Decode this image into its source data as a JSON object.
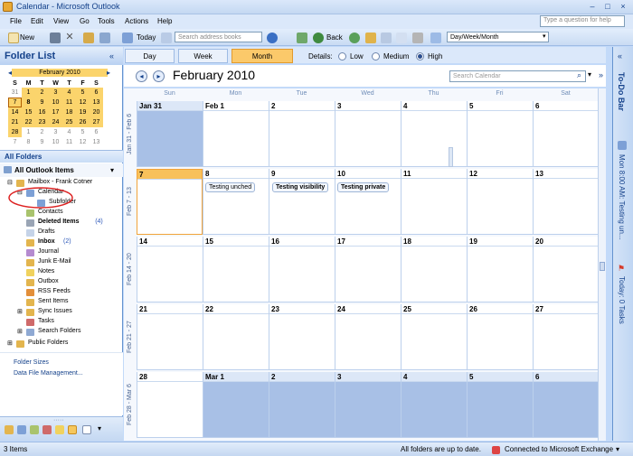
{
  "window": {
    "title": "Calendar - Microsoft Outlook",
    "controls": [
      "–",
      "□",
      "×"
    ]
  },
  "menu": [
    "File",
    "Edit",
    "View",
    "Go",
    "Tools",
    "Actions",
    "Help"
  ],
  "help_placeholder": "Type a question for help",
  "toolbar": {
    "new": "New",
    "today": "Today",
    "search_placeholder": "Search address books",
    "back": "Back",
    "view_select": "Day/Week/Month"
  },
  "folder_list": {
    "title": "Folder List",
    "mini_calendar": {
      "month": "February 2010",
      "dow": [
        "S",
        "M",
        "T",
        "W",
        "T",
        "F",
        "S"
      ],
      "weeks": [
        [
          "31",
          "1",
          "2",
          "3",
          "4",
          "5",
          "6"
        ],
        [
          "7",
          "8",
          "9",
          "10",
          "11",
          "12",
          "13"
        ],
        [
          "14",
          "15",
          "16",
          "17",
          "18",
          "19",
          "20"
        ],
        [
          "21",
          "22",
          "23",
          "24",
          "25",
          "26",
          "27"
        ],
        [
          "28",
          "1",
          "2",
          "3",
          "4",
          "5",
          "6"
        ],
        [
          "7",
          "8",
          "9",
          "10",
          "11",
          "12",
          "13"
        ]
      ]
    },
    "all_folders": "All Folders",
    "all_items": "All Outlook Items",
    "mailbox": "Mailbox - Frank Cotner",
    "folders": [
      {
        "name": "Calendar",
        "indent": 1
      },
      {
        "name": "Subfolder",
        "indent": 2
      },
      {
        "name": "Contacts",
        "indent": 1
      },
      {
        "name": "Deleted Items",
        "count": "(4)",
        "bold": true,
        "indent": 1
      },
      {
        "name": "Drafts",
        "indent": 1
      },
      {
        "name": "Inbox",
        "count": "(2)",
        "bold": true,
        "indent": 1
      },
      {
        "name": "Journal",
        "indent": 1
      },
      {
        "name": "Junk E-Mail",
        "indent": 1
      },
      {
        "name": "Notes",
        "indent": 1
      },
      {
        "name": "Outbox",
        "indent": 1
      },
      {
        "name": "RSS Feeds",
        "indent": 1
      },
      {
        "name": "Sent Items",
        "indent": 1
      },
      {
        "name": "Sync Issues",
        "indent": 1
      },
      {
        "name": "Tasks",
        "indent": 1
      },
      {
        "name": "Search Folders",
        "indent": 1
      }
    ],
    "public": "Public Folders",
    "links": [
      "Folder Sizes",
      "Data File Management..."
    ]
  },
  "view": {
    "tabs": [
      "Day",
      "Week",
      "Month"
    ],
    "active": "Month",
    "details_label": "Details:",
    "details": [
      "Low",
      "Medium",
      "High"
    ],
    "details_selected": "High"
  },
  "calendar": {
    "title": "February 2010",
    "search_placeholder": "Search Calendar",
    "dow": [
      "Sun",
      "Mon",
      "Tue",
      "Wed",
      "Thu",
      "Fri",
      "Sat"
    ],
    "weeks": [
      {
        "label": "Jan 31 - Feb 6",
        "days": [
          "Jan 31",
          "Feb 1",
          "2",
          "3",
          "4",
          "5",
          "6"
        ]
      },
      {
        "label": "Feb 7 - 13",
        "days": [
          "7",
          "8",
          "9",
          "10",
          "11",
          "12",
          "13"
        ]
      },
      {
        "label": "Feb 14 - 20",
        "days": [
          "14",
          "15",
          "16",
          "17",
          "18",
          "19",
          "20"
        ]
      },
      {
        "label": "Feb 21 - 27",
        "days": [
          "21",
          "22",
          "23",
          "24",
          "25",
          "26",
          "27"
        ]
      },
      {
        "label": "Feb 28 - Mar 6",
        "days": [
          "28",
          "Mar 1",
          "2",
          "3",
          "4",
          "5",
          "6"
        ]
      }
    ],
    "appointments": [
      {
        "text": "Testing unched",
        "bold": false
      },
      {
        "text": "Testing visibility",
        "bold": true
      },
      {
        "text": "Testing private",
        "bold": true
      }
    ]
  },
  "todo_bar": {
    "title": "To-Do Bar",
    "appointment": "Mon 8:00 AM: Testing un...",
    "tasks": "Today: 0 Tasks"
  },
  "status": {
    "items": "3 Items",
    "updated": "All folders are up to date.",
    "connection": "Connected to Microsoft Exchange"
  }
}
